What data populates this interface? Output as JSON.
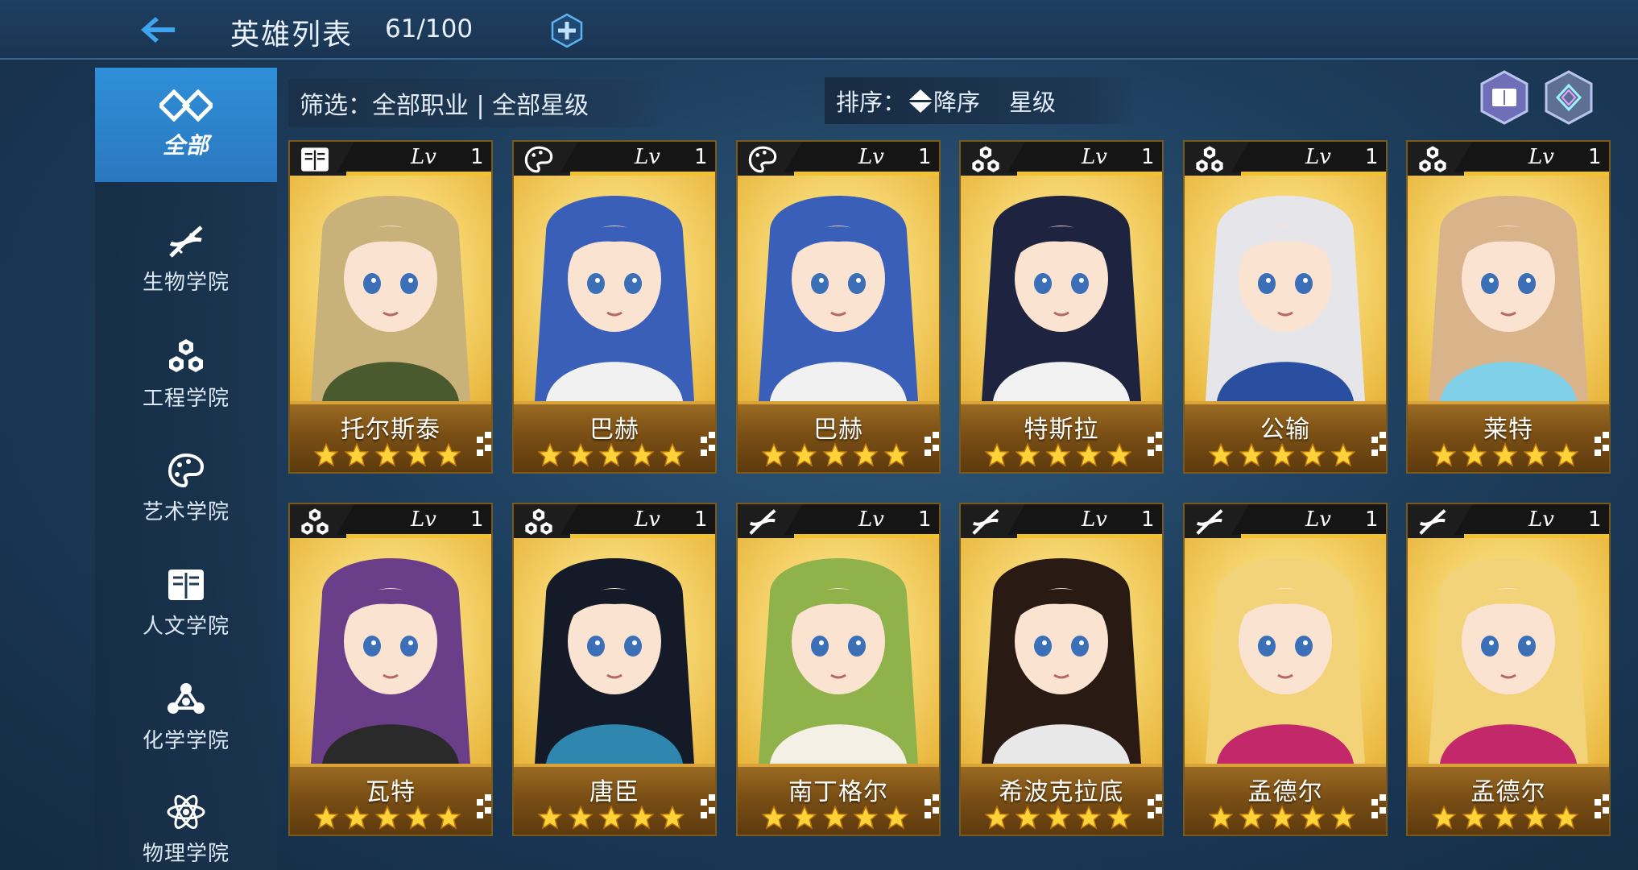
{
  "header": {
    "title": "英雄列表",
    "count": "61/100",
    "back_icon": "back-arrow-icon",
    "add_icon": "plus-icon"
  },
  "sidebar": {
    "items": [
      {
        "label": "全部",
        "icon": "all-infinity-icon",
        "active": true
      },
      {
        "label": "生物学院",
        "icon": "dna-icon"
      },
      {
        "label": "工程学院",
        "icon": "gear-cluster-icon"
      },
      {
        "label": "艺术学院",
        "icon": "palette-icon"
      },
      {
        "label": "人文学院",
        "icon": "book-icon"
      },
      {
        "label": "化学学院",
        "icon": "molecule-icon"
      },
      {
        "label": "物理学院",
        "icon": "atom-icon"
      }
    ]
  },
  "filter": {
    "text": "筛选：全部职业 | 全部星级"
  },
  "sort": {
    "label": "排序：",
    "order": "降序",
    "field": "星级"
  },
  "toolbar": {
    "codex_icon": "book-hex-icon",
    "gallery_icon": "diamond-hex-icon"
  },
  "colors": {
    "accent_blue": "#2f8fd8",
    "gold": "#f1c22d",
    "plate": "#7a4f15"
  },
  "lv_label": "Lv",
  "heroes": [
    {
      "name": "托尔斯泰",
      "level": "1",
      "stars": 5,
      "college": "book-icon",
      "hair": "#c9b27a",
      "outfit": "#4a5a2f"
    },
    {
      "name": "巴赫",
      "level": "1",
      "stars": 5,
      "college": "palette-icon",
      "hair": "#3a5fb8",
      "outfit": "#f1f1f1"
    },
    {
      "name": "巴赫",
      "level": "1",
      "stars": 5,
      "college": "palette-icon",
      "hair": "#3a5fb8",
      "outfit": "#f1f1f1"
    },
    {
      "name": "特斯拉",
      "level": "1",
      "stars": 5,
      "college": "gear-cluster-icon",
      "hair": "#1e2440",
      "outfit": "#f2f2f2"
    },
    {
      "name": "公输",
      "level": "1",
      "stars": 5,
      "college": "gear-cluster-icon",
      "hair": "#e6e6ea",
      "outfit": "#2a4fa0"
    },
    {
      "name": "莱特",
      "level": "1",
      "stars": 5,
      "college": "gear-cluster-icon",
      "hair": "#d9b48a",
      "outfit": "#7fd0e8"
    },
    {
      "name": "瓦特",
      "level": "1",
      "stars": 5,
      "college": "gear-cluster-icon",
      "hair": "#6b3e8a",
      "outfit": "#2a2a2a"
    },
    {
      "name": "唐臣",
      "level": "1",
      "stars": 5,
      "college": "gear-cluster-icon",
      "hair": "#151a28",
      "outfit": "#2f87b0"
    },
    {
      "name": "南丁格尔",
      "level": "1",
      "stars": 5,
      "college": "dna-icon",
      "hair": "#8fb24a",
      "outfit": "#f4f0e6"
    },
    {
      "name": "希波克拉底",
      "level": "1",
      "stars": 5,
      "college": "dna-icon",
      "hair": "#2a1a14",
      "outfit": "#e8e8e8"
    },
    {
      "name": "孟德尔",
      "level": "1",
      "stars": 5,
      "college": "dna-icon",
      "hair": "#f2d37a",
      "outfit": "#c2286a"
    },
    {
      "name": "孟德尔",
      "level": "1",
      "stars": 5,
      "college": "dna-icon",
      "hair": "#f2d37a",
      "outfit": "#c2286a"
    }
  ]
}
